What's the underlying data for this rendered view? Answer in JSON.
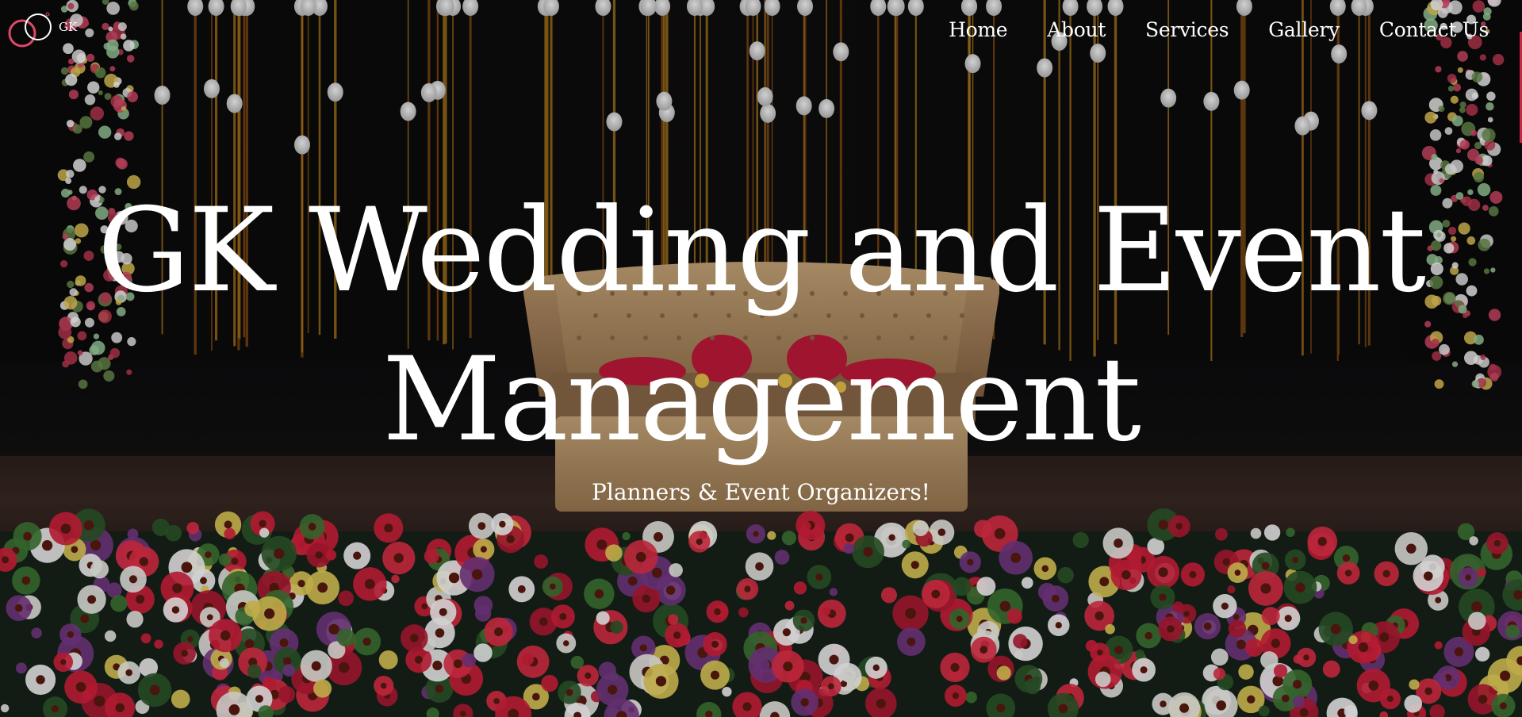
{
  "brand": {
    "logo_text": "GK",
    "ring_color_1": "#e0486a",
    "ring_color_2": "#ffffff"
  },
  "nav": {
    "items": [
      {
        "label": "Home"
      },
      {
        "label": "About"
      },
      {
        "label": "Services"
      },
      {
        "label": "Gallery"
      },
      {
        "label": "Contact Us"
      }
    ]
  },
  "hero": {
    "title_line1": "GK Wedding and Event",
    "title_line2": "Management",
    "subtitle": "Planners & Event Organizers!",
    "background_image": "wedding-stage-couch-flowers"
  }
}
